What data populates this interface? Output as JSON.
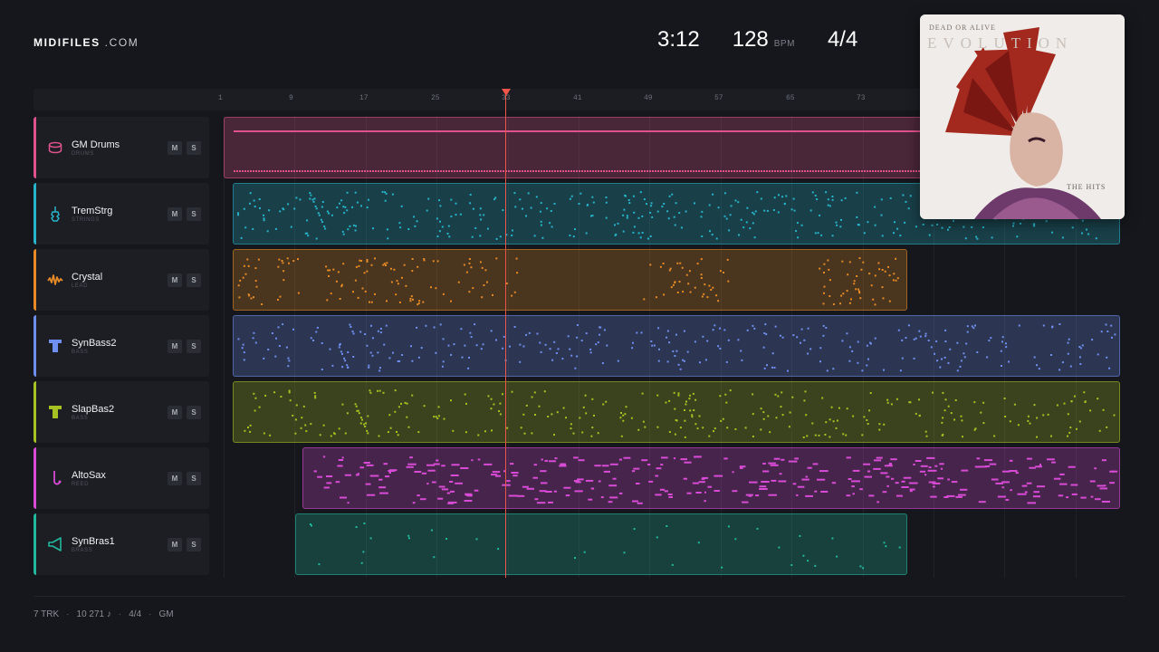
{
  "app": {
    "brand": "MIDIFILES",
    "brand_suffix": ".COM"
  },
  "transport": {
    "time": "3:12",
    "bpm": "128",
    "bpm_unit": "BPM",
    "signature": "4/4"
  },
  "ruler": {
    "bars": [
      "1",
      "9",
      "17",
      "25",
      "33",
      "41",
      "49",
      "57",
      "65",
      "73"
    ]
  },
  "tracks": [
    {
      "name": "GM Drums",
      "category": "DRUMS",
      "color": "#e0528c",
      "icon": "drum-icon",
      "mute": "M",
      "solo": "S"
    },
    {
      "name": "TremStrg",
      "category": "STRINGS",
      "color": "#27b3c9",
      "icon": "violin-icon",
      "mute": "M",
      "solo": "S"
    },
    {
      "name": "Crystal",
      "category": "LEAD",
      "color": "#e58a26",
      "icon": "wave-icon",
      "mute": "M",
      "solo": "S"
    },
    {
      "name": "SynBass2",
      "category": "BASS",
      "color": "#6f8ff0",
      "icon": "bass-icon",
      "mute": "M",
      "solo": "S"
    },
    {
      "name": "SlapBas2",
      "category": "BASS",
      "color": "#a6c222",
      "icon": "bass-icon",
      "mute": "M",
      "solo": "S"
    },
    {
      "name": "AltoSax",
      "category": "REED",
      "color": "#d84bd6",
      "icon": "sax-icon",
      "mute": "M",
      "solo": "S"
    },
    {
      "name": "SynBras1",
      "category": "BRASS",
      "color": "#22b89d",
      "icon": "horn-icon",
      "mute": "M",
      "solo": "S"
    }
  ],
  "album": {
    "artist": "DEAD OR ALIVE",
    "title": "EVOLUTION",
    "subtitle": "THE HITS"
  },
  "footer": {
    "tracks": "7 TRK",
    "notes": "10 271 ♪",
    "signature": "4/4",
    "standard": "GM"
  }
}
